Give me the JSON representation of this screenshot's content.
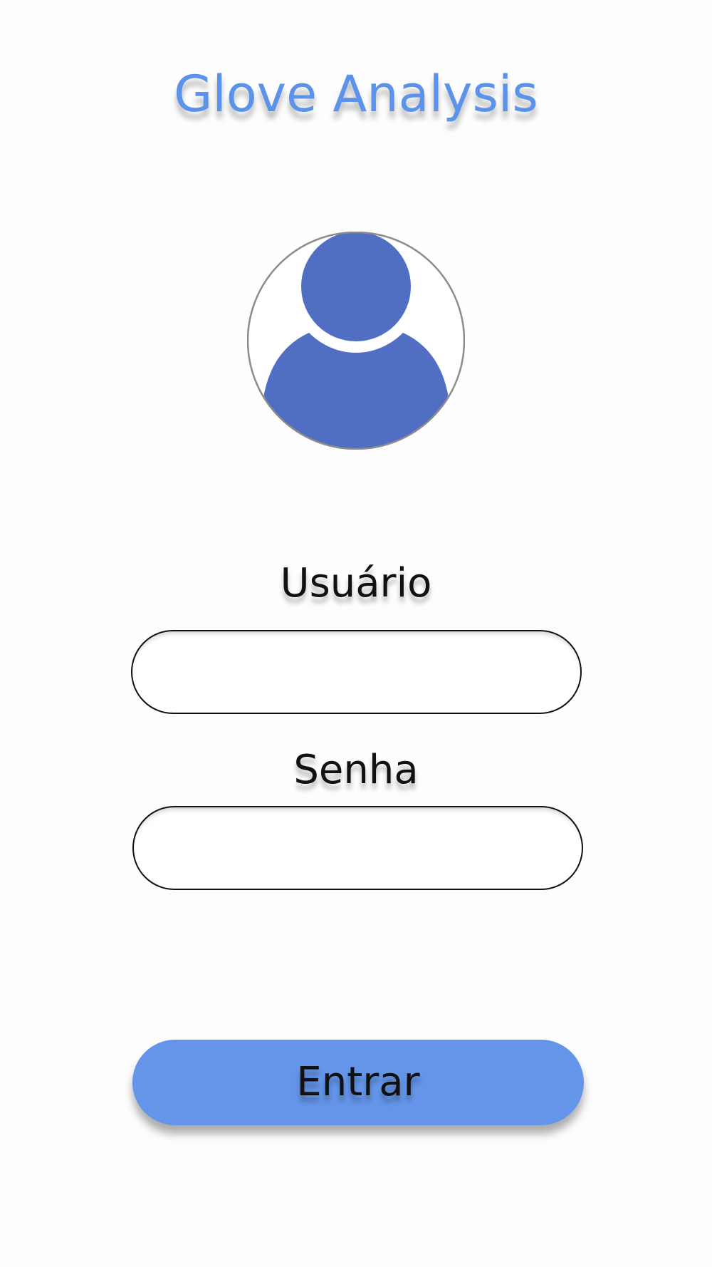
{
  "app": {
    "title": "Glove Analysis"
  },
  "avatar": {
    "icon": "user-avatar-icon",
    "color": "#506ec2"
  },
  "form": {
    "username_label": "Usuário",
    "username_value": "",
    "password_label": "Senha",
    "password_value": "",
    "submit_label": "Entrar"
  },
  "colors": {
    "title": "#5b92ea",
    "button": "#6495e9",
    "avatar": "#506ec2"
  }
}
